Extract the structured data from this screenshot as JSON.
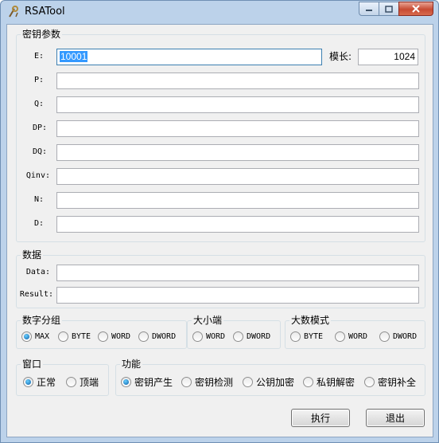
{
  "window": {
    "title": "RSATool"
  },
  "key_params": {
    "legend": "密钥参数",
    "fields": [
      {
        "label": "E:",
        "value": "10001"
      },
      {
        "label": "P:",
        "value": ""
      },
      {
        "label": "Q:",
        "value": ""
      },
      {
        "label": "DP:",
        "value": ""
      },
      {
        "label": "DQ:",
        "value": ""
      },
      {
        "label": "Qinv:",
        "value": ""
      },
      {
        "label": "N:",
        "value": ""
      },
      {
        "label": "D:",
        "value": ""
      }
    ],
    "modulus": {
      "label": "模长:",
      "value": "1024"
    }
  },
  "data_group": {
    "legend": "数据",
    "fields": [
      {
        "label": "Data:",
        "value": ""
      },
      {
        "label": "Result:",
        "value": ""
      }
    ]
  },
  "number_grouping": {
    "legend": "数字分组",
    "options": [
      "MAX",
      "BYTE",
      "WORD",
      "DWORD"
    ],
    "selected": "MAX"
  },
  "endianness": {
    "legend": "大小端",
    "options": [
      "WORD",
      "DWORD"
    ],
    "selected": ""
  },
  "bignum_mode": {
    "legend": "大数模式",
    "options": [
      "BYTE",
      "WORD",
      "DWORD"
    ],
    "selected": ""
  },
  "window_mode": {
    "legend": "窗口",
    "options": [
      "正常",
      "顶端"
    ],
    "selected": "正常"
  },
  "function": {
    "legend": "功能",
    "options": [
      "密钥产生",
      "密钥检测",
      "公钥加密",
      "私钥解密",
      "密钥补全"
    ],
    "selected": "密钥产生"
  },
  "buttons": {
    "execute": "执行",
    "exit": "退出"
  }
}
